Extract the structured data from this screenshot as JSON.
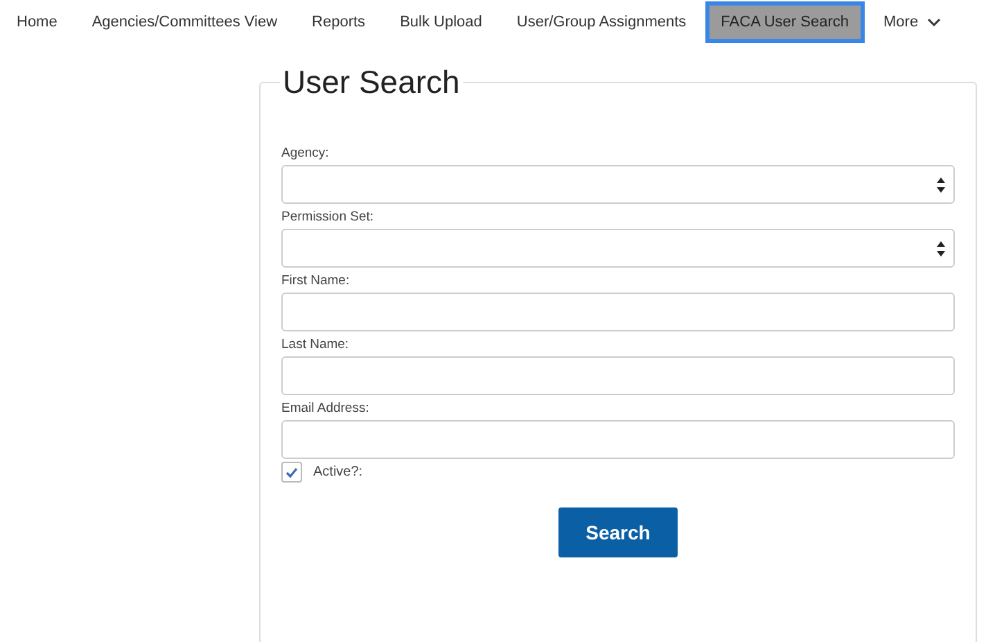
{
  "nav": [
    {
      "label": "Home",
      "selected": false
    },
    {
      "label": "Agencies/Committees View",
      "selected": false
    },
    {
      "label": "Reports",
      "selected": false
    },
    {
      "label": "Bulk Upload",
      "selected": false
    },
    {
      "label": "User/Group Assignments",
      "selected": false
    },
    {
      "label": "FACA User Search",
      "selected": true
    },
    {
      "label": "More",
      "selected": false,
      "kind": "dropdown"
    }
  ],
  "form": {
    "title": "User Search",
    "fields": [
      {
        "label": "Agency:",
        "kind": "select"
      },
      {
        "label": "Permission Set:",
        "kind": "select"
      },
      {
        "label": "First Name:",
        "kind": "text"
      },
      {
        "label": "Last Name:",
        "kind": "text"
      },
      {
        "label": "Email Address:",
        "kind": "text"
      }
    ],
    "active": {
      "label": "Active?:",
      "checked": true
    },
    "button": "Search"
  }
}
